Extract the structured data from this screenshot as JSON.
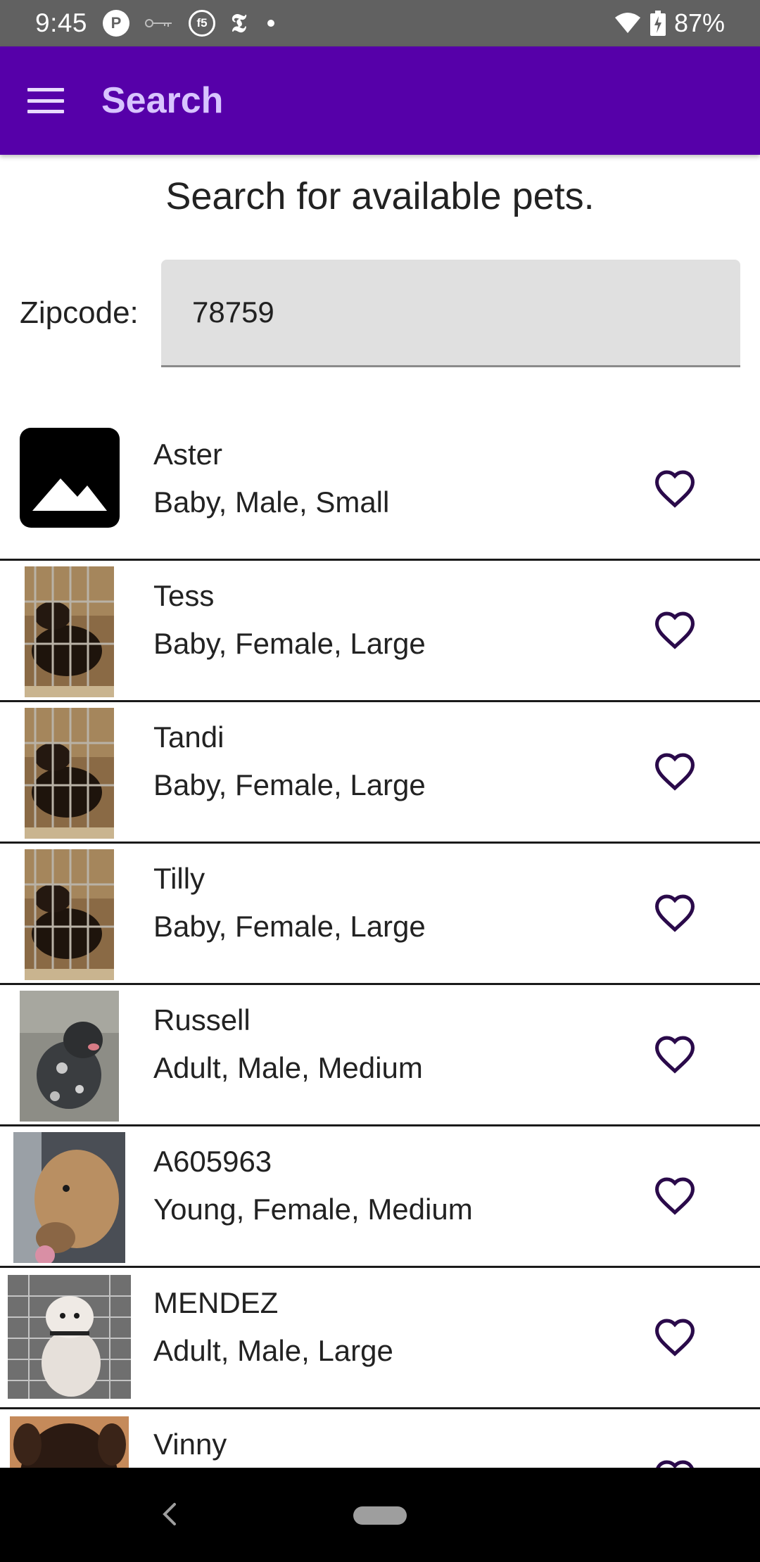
{
  "status_bar": {
    "time": "9:45",
    "battery": "87%",
    "icons": [
      "pocket-casts-icon",
      "key-icon",
      "f5-icon",
      "nyt-icon",
      "notification-dot-icon",
      "wifi-icon",
      "battery-charging-icon"
    ]
  },
  "app_bar": {
    "title": "Search",
    "menu_icon": "hamburger-menu-icon"
  },
  "search": {
    "heading": "Search for available pets.",
    "zip_label": "Zipcode:",
    "zip_value": "78759"
  },
  "pets": [
    {
      "name": "Aster",
      "details": "Baby, Male, Small",
      "photo": "placeholder"
    },
    {
      "name": "Tess",
      "details": "Baby, Female, Large",
      "photo": "kennel-puppies"
    },
    {
      "name": "Tandi",
      "details": "Baby, Female, Large",
      "photo": "kennel-puppies"
    },
    {
      "name": "Tilly",
      "details": "Baby, Female, Large",
      "photo": "kennel-puppies"
    },
    {
      "name": "Russell",
      "details": "Adult, Male, Medium",
      "photo": "merle-dog"
    },
    {
      "name": "A605963",
      "details": "Young, Female, Medium",
      "photo": "tan-dog"
    },
    {
      "name": "MENDEZ",
      "details": "Adult, Male, Large",
      "photo": "white-pitbull"
    },
    {
      "name": "Vinny",
      "details": "",
      "photo": "dark-puppy"
    }
  ],
  "favorite_icon": "heart-outline-icon",
  "colors": {
    "app_bar": "#5600a9",
    "app_title": "#d8c4ff",
    "status_bar": "#616161",
    "heart": "#2a0a4a"
  }
}
